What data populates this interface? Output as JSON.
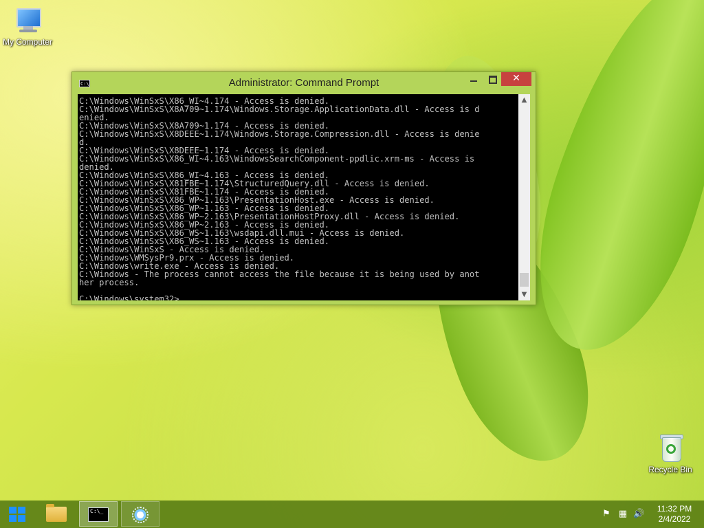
{
  "desktop": {
    "icons": [
      {
        "label": "My Computer"
      },
      {
        "label": "Recycle Bin"
      }
    ]
  },
  "window": {
    "title": "Administrator: Command Prompt",
    "title_icon_text": "C:\\",
    "close_glyph": "✕",
    "console_lines": [
      "C:\\Windows\\WinSxS\\X86_WI~4.174 - Access is denied.",
      "C:\\Windows\\WinSxS\\X8A709~1.174\\Windows.Storage.ApplicationData.dll - Access is d",
      "enied.",
      "C:\\Windows\\WinSxS\\X8A709~1.174 - Access is denied.",
      "C:\\Windows\\WinSxS\\X8DEEE~1.174\\Windows.Storage.Compression.dll - Access is denie",
      "d.",
      "C:\\Windows\\WinSxS\\X8DEEE~1.174 - Access is denied.",
      "C:\\Windows\\WinSxS\\X86_WI~4.163\\WindowsSearchComponent-ppdlic.xrm-ms - Access is",
      "denied.",
      "C:\\Windows\\WinSxS\\X86_WI~4.163 - Access is denied.",
      "C:\\Windows\\WinSxS\\X81FBE~1.174\\StructuredQuery.dll - Access is denied.",
      "C:\\Windows\\WinSxS\\X81FBE~1.174 - Access is denied.",
      "C:\\Windows\\WinSxS\\X86_WP~1.163\\PresentationHost.exe - Access is denied.",
      "C:\\Windows\\WinSxS\\X86_WP~1.163 - Access is denied.",
      "C:\\Windows\\WinSxS\\X86_WP~2.163\\PresentationHostProxy.dll - Access is denied.",
      "C:\\Windows\\WinSxS\\X86_WP~2.163 - Access is denied.",
      "C:\\Windows\\WinSxS\\X86_WS~1.163\\wsdapi.dll.mui - Access is denied.",
      "C:\\Windows\\WinSxS\\X86_WS~1.163 - Access is denied.",
      "C:\\Windows\\WinSxS - Access is denied.",
      "C:\\Windows\\WMSysPr9.prx - Access is denied.",
      "C:\\Windows\\write.exe - Access is denied.",
      "C:\\Windows - The process cannot access the file because it is being used by anot",
      "her process.",
      "",
      "C:\\Windows\\system32>"
    ]
  },
  "taskbar": {
    "cmd_icon_text": "C:\\_",
    "clock_time": "11:32 PM",
    "clock_date": "2/4/2022",
    "tray_glyphs": {
      "flag": "⚑",
      "network": "▦",
      "volume": "🔊"
    }
  },
  "colors": {
    "taskbar": "#5c8016",
    "window_frame": "#b4d55a",
    "close_button": "#c7423f",
    "console_bg": "#000000",
    "console_text": "#c0c0c0"
  }
}
